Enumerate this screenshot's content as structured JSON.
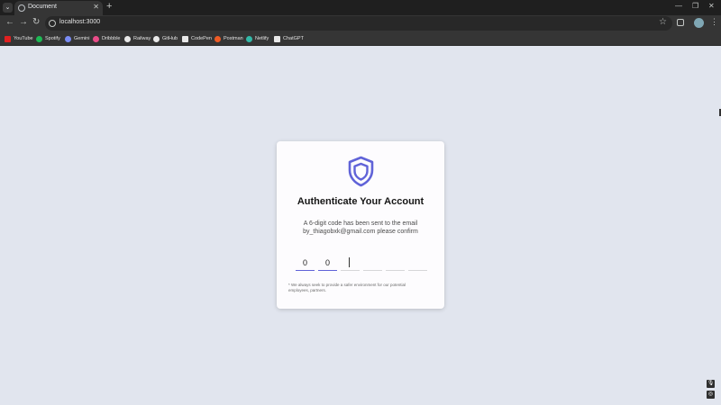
{
  "browser": {
    "tab_title": "Document",
    "url": "localhost:3000",
    "bookmarks": [
      {
        "label": "YouTube",
        "color": "#e02020",
        "icon": "youtube-icon"
      },
      {
        "label": "Spotify",
        "color": "#1db954",
        "icon": "spotify-icon"
      },
      {
        "label": "Gemini",
        "color": "#7a8cf5",
        "icon": "gemini-icon"
      },
      {
        "label": "Dribbble",
        "color": "#ea4c89",
        "icon": "dribbble-icon"
      },
      {
        "label": "Railway",
        "color": "#e8e8e8",
        "icon": "railway-icon"
      },
      {
        "label": "GitHub",
        "color": "#e8e8e8",
        "icon": "github-icon"
      },
      {
        "label": "CodePen",
        "color": "#e8e8e8",
        "icon": "codepen-icon"
      },
      {
        "label": "Postman",
        "color": "#ef5b25",
        "icon": "postman-icon"
      },
      {
        "label": "Netlify",
        "color": "#32b9a8",
        "icon": "netlify-icon"
      },
      {
        "label": "ChatGPT",
        "color": "#e8e8e8",
        "icon": "chatgpt-icon"
      }
    ]
  },
  "auth": {
    "title": "Authenticate Your Account",
    "description": "A 6-digit code has been sent to the email by_thiagobxk@gmail.com please confirm",
    "digits": [
      "0",
      "0",
      "",
      "",
      "",
      ""
    ],
    "note": "* We always seek to provide a safer environment for our potential employees, partners.",
    "accent_color": "#6063d8",
    "icon": "shield-icon"
  }
}
